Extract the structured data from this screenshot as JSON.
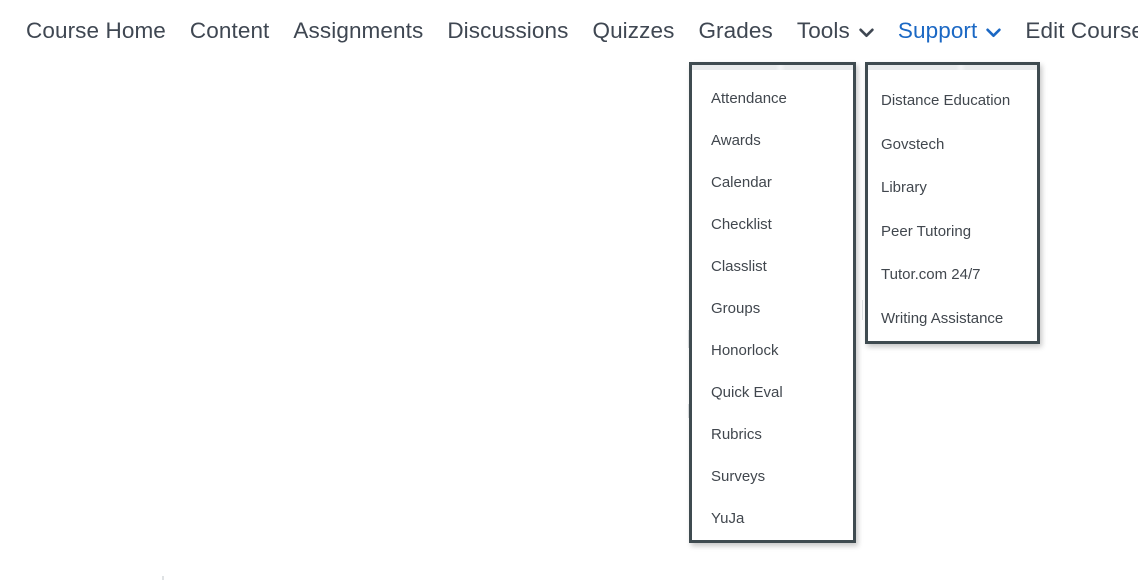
{
  "navbar": {
    "items": [
      {
        "label": "Course Home",
        "has_caret": false,
        "active": false
      },
      {
        "label": "Content",
        "has_caret": false,
        "active": false
      },
      {
        "label": "Assignments",
        "has_caret": false,
        "active": false
      },
      {
        "label": "Discussions",
        "has_caret": false,
        "active": false
      },
      {
        "label": "Quizzes",
        "has_caret": false,
        "active": false
      },
      {
        "label": "Grades",
        "has_caret": false,
        "active": false
      },
      {
        "label": "Tools",
        "has_caret": true,
        "active": false
      },
      {
        "label": "Support",
        "has_caret": true,
        "active": true
      },
      {
        "label": "Edit Course",
        "has_caret": false,
        "active": false
      }
    ]
  },
  "tools_menu": {
    "items": [
      {
        "label": "Attendance"
      },
      {
        "label": "Awards"
      },
      {
        "label": "Calendar"
      },
      {
        "label": "Checklist"
      },
      {
        "label": "Classlist"
      },
      {
        "label": "Groups"
      },
      {
        "label": "Honorlock"
      },
      {
        "label": "Quick Eval"
      },
      {
        "label": "Rubrics"
      },
      {
        "label": "Surveys"
      },
      {
        "label": "YuJa"
      }
    ]
  },
  "support_menu": {
    "items": [
      {
        "label": "Distance Education"
      },
      {
        "label": "Govstech"
      },
      {
        "label": "Library"
      },
      {
        "label": "Peer Tutoring"
      },
      {
        "label": "Tutor.com 24/7"
      },
      {
        "label": "Writing Assistance"
      }
    ]
  },
  "colors": {
    "nav_text": "#3f4752",
    "nav_active": "#1b68c4",
    "menu_text": "#41474e",
    "menu_border": "#3f4b50",
    "page_background": "#ffffff"
  }
}
